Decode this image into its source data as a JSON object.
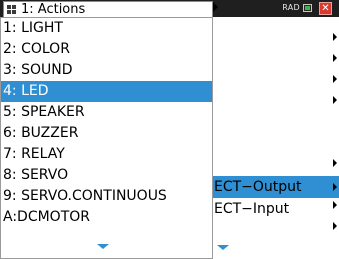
{
  "header": {
    "tab_label": "1: Actions",
    "mode_label": "RAD",
    "tab_icon": "document-grid-icon",
    "battery_icon": "battery-icon",
    "close_icon": "close-icon"
  },
  "menu": {
    "items": [
      {
        "label": "1: LIGHT"
      },
      {
        "label": "2: COLOR"
      },
      {
        "label": "3: SOUND"
      },
      {
        "label": "4: LED",
        "selected": true
      },
      {
        "label": "5: SPEAKER"
      },
      {
        "label": "6: BUZZER"
      },
      {
        "label": "7: RELAY"
      },
      {
        "label": "8: SERVO"
      },
      {
        "label": "9: SERVO.CONTINUOUS"
      },
      {
        "label": "A:DCMOTOR"
      }
    ],
    "scroll_icon": "scroll-down-icon"
  },
  "submenu": {
    "items": [
      {
        "label": "ECT−Output",
        "selected": true
      },
      {
        "label": "ECT−Input"
      }
    ],
    "scroll_icon": "scroll-down-icon"
  },
  "colors": {
    "accent": "#2f8fd2",
    "title_bar": "#1f1f1f",
    "close": "#d93a2f",
    "battery": "#39b54a"
  }
}
